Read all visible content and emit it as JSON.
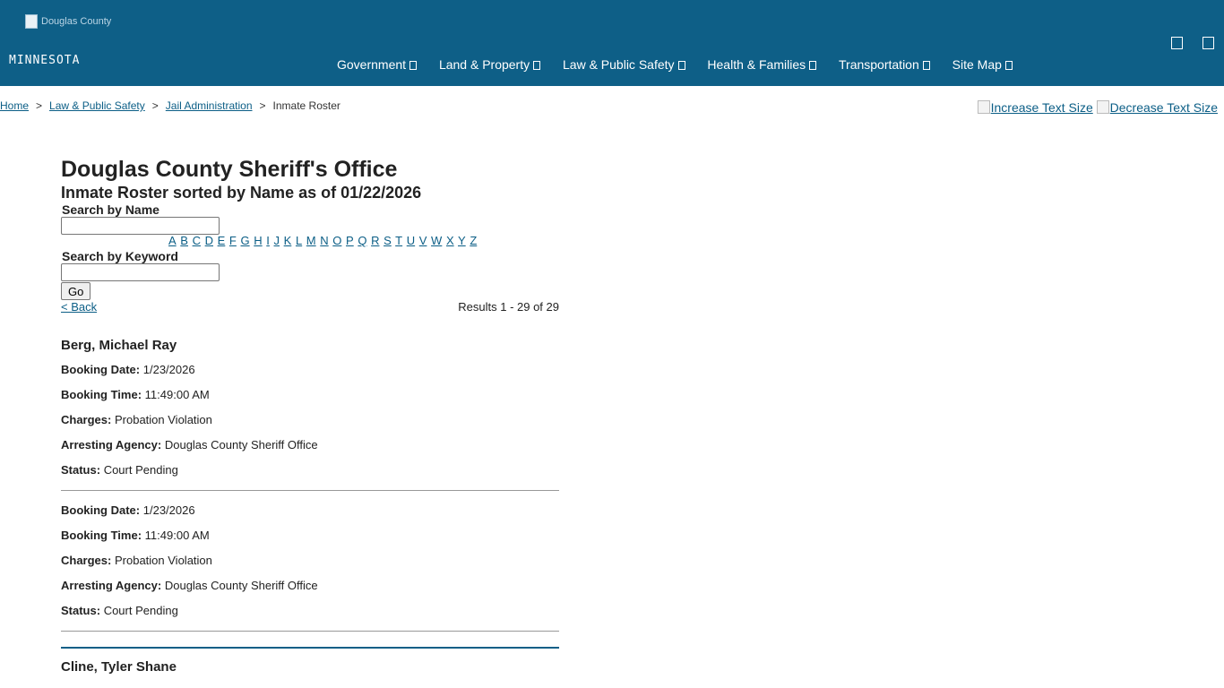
{
  "header": {
    "logo_alt": "Douglas County",
    "logo_text": "MINNESOTA",
    "nav": [
      {
        "label": "Government"
      },
      {
        "label": "Land & Property"
      },
      {
        "label": "Law & Public Safety"
      },
      {
        "label": "Health & Families"
      },
      {
        "label": "Transportation"
      },
      {
        "label": "Site Map"
      }
    ],
    "background": "#0e5f87"
  },
  "breadcrumb": {
    "items": [
      "Home",
      "Law & Public Safety",
      "Jail Administration"
    ],
    "current": "Inmate Roster",
    "separator": ">"
  },
  "text_size": {
    "increase": "Increase Text Size",
    "decrease": "Decrease Text Size"
  },
  "page": {
    "title": "Douglas County Sheriff's Office",
    "subtitle": "Inmate Roster sorted by Name as of 01/22/2026"
  },
  "search": {
    "by_name_label": "Search by Name",
    "name_value": "",
    "letters": [
      "A",
      "B",
      "C",
      "D",
      "E",
      "F",
      "G",
      "H",
      "I",
      "J",
      "K",
      "L",
      "M",
      "N",
      "O",
      "P",
      "Q",
      "R",
      "S",
      "T",
      "U",
      "V",
      "W",
      "X",
      "Y",
      "Z"
    ],
    "by_keyword_label": "Search by Keyword",
    "keyword_value": "",
    "go_label": "Go"
  },
  "results": {
    "back_label": "< Back",
    "count_text": "Results 1 - 29 of 29"
  },
  "labels": {
    "booking_date": "Booking Date:",
    "booking_time": "Booking Time:",
    "charges": "Charges:",
    "arresting_agency": "Arresting Agency:",
    "status": "Status:"
  },
  "inmates": [
    {
      "name": "Berg, Michael Ray",
      "bookings": [
        {
          "booking_date": "1/23/2026",
          "booking_time": "11:49:00 AM",
          "charges": "Probation Violation",
          "arresting_agency": "Douglas County Sheriff Office",
          "status": "Court Pending"
        },
        {
          "booking_date": "1/23/2026",
          "booking_time": "11:49:00 AM",
          "charges": "Probation Violation",
          "arresting_agency": "Douglas County Sheriff Office",
          "status": "Court Pending"
        }
      ]
    },
    {
      "name": "Cline, Tyler Shane"
    }
  ]
}
